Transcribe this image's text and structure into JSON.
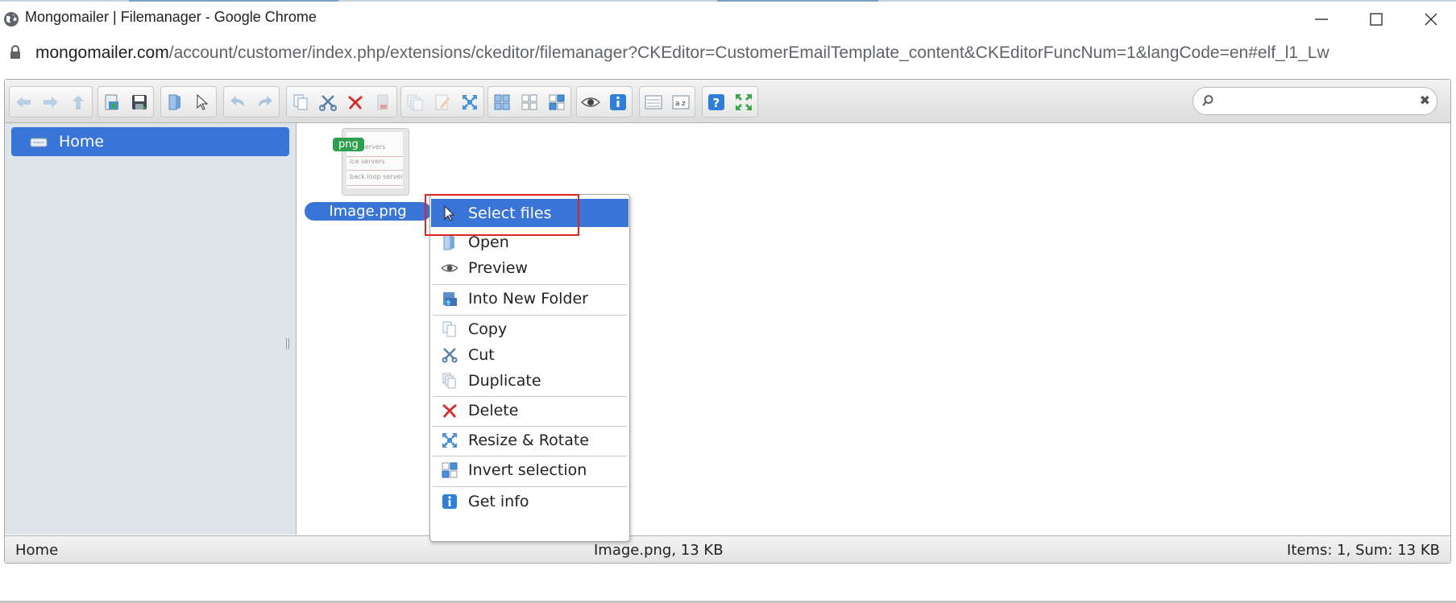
{
  "window": {
    "title": "Mongomailer | Filemanager - Google Chrome",
    "url_host": "mongomailer.com",
    "url_path": "/account/customer/index.php/extensions/ckeditor/filemanager?CKEditor=CustomerEmailTemplate_content&CKEditorFuncNum=1&langCode=en#elf_l1_Lw"
  },
  "toolbar": {
    "groups": [
      [
        "back-icon",
        "forward-icon",
        "up-icon"
      ],
      [
        "upload-icon",
        "save-icon"
      ],
      [
        "open-icon",
        "select-icon"
      ],
      [
        "undo-icon",
        "redo-icon"
      ],
      [
        "copy-icon",
        "cut-icon",
        "delete-icon",
        "empty-icon"
      ],
      [
        "duplicate-icon",
        "rename-icon",
        "resize-icon"
      ],
      [
        "select-all-icon",
        "select-none-icon",
        "invert-icon"
      ],
      [
        "preview-icon",
        "info-icon"
      ],
      [
        "view-list-icon",
        "sort-icon"
      ],
      [
        "help-icon",
        "fullscreen-icon"
      ]
    ],
    "search_placeholder": ""
  },
  "nav": {
    "home_label": "Home"
  },
  "file": {
    "name": "Image.png",
    "badge": "png"
  },
  "statusbar": {
    "path": "Home",
    "selected": "Image.png, 13 KB",
    "summary": "Items: 1, Sum: 13 KB"
  },
  "context_menu": {
    "items": [
      {
        "label": "Select files",
        "icon": "cursor-icon"
      },
      {
        "label": "Open",
        "icon": "open-icon"
      },
      {
        "label": "Preview",
        "icon": "eye-icon"
      },
      {
        "label": "Into New Folder",
        "icon": "new-folder-icon"
      },
      {
        "label": "Copy",
        "icon": "copy-icon"
      },
      {
        "label": "Cut",
        "icon": "cut-icon"
      },
      {
        "label": "Duplicate",
        "icon": "duplicate-icon"
      },
      {
        "label": "Delete",
        "icon": "delete-icon"
      },
      {
        "label": "Resize & Rotate",
        "icon": "resize-icon"
      },
      {
        "label": "Invert selection",
        "icon": "invert-icon"
      },
      {
        "label": "Get info",
        "icon": "info-icon"
      }
    ]
  },
  "colors": {
    "accent": "#3875d7",
    "highlight_box": "#e02424",
    "badge": "#2e9e4f"
  }
}
